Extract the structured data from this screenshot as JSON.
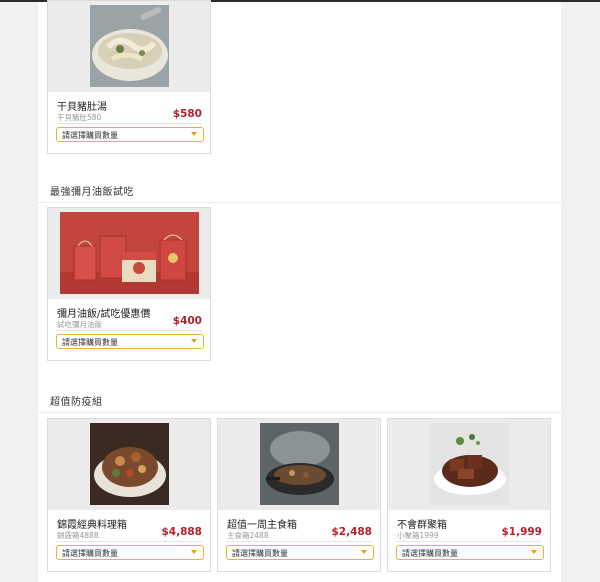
{
  "select_placeholder": "請選擇購買數量",
  "sections": [
    {
      "title": "",
      "products": [
        {
          "name": "干貝豬肚湯",
          "subtitle": "干貝豬肚580",
          "price": "$580"
        }
      ]
    },
    {
      "title": "最強彌月油飯試吃",
      "products": [
        {
          "name": "彌月油飯/試吃優惠價",
          "subtitle": "試吃彌月油飯",
          "price": "$400"
        }
      ]
    },
    {
      "title": "超值防疫組",
      "products": [
        {
          "name": "錦霞經典料理箱",
          "subtitle": "錦霞箱4888",
          "price": "$4,888"
        },
        {
          "name": "超值一周主食箱",
          "subtitle": "主食箱2488",
          "price": "$2,488"
        },
        {
          "name": "不會群聚箱",
          "subtitle": "小聚箱1999",
          "price": "$1,999"
        }
      ]
    }
  ],
  "colors": {
    "price": "#b5212a",
    "select_border": "#e6b23a",
    "page_bg": "#f1f1f1"
  },
  "icons": [
    "chevron-down-icon"
  ]
}
